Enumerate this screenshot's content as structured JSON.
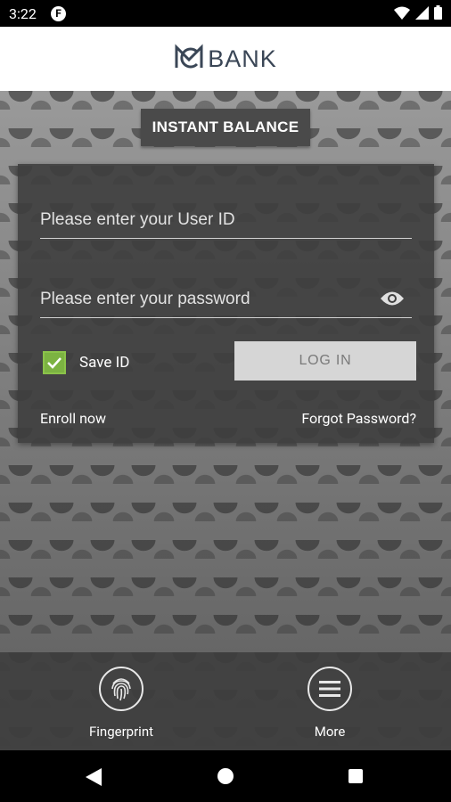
{
  "status_bar": {
    "time": "3:22",
    "app_icon_letter": "F",
    "icons": [
      "wifi-icon",
      "cellular-icon",
      "battery-icon"
    ]
  },
  "header": {
    "logo_icon": "mc-logo-icon",
    "logo_text": "BANK"
  },
  "instant_balance": {
    "label": "INSTANT BALANCE"
  },
  "login": {
    "user_id_placeholder": "Please enter your User ID",
    "password_placeholder": "Please enter your password",
    "show_password_icon": "eye-icon",
    "save_id_label": "Save ID",
    "save_id_checked": true,
    "login_button_label": "LOG IN",
    "enroll_label": "Enroll now",
    "forgot_password_label": "Forgot Password?"
  },
  "bottom_nav": {
    "items": [
      {
        "label": "Fingerprint",
        "icon": "fingerprint-icon"
      },
      {
        "label": "More",
        "icon": "menu-icon"
      }
    ]
  },
  "system_nav": {
    "icons": [
      "back-icon",
      "home-icon",
      "recent-apps-icon"
    ]
  },
  "colors": {
    "accent_green": "#7cb342",
    "card_bg": "#3e3e3e",
    "logo_text": "#3a4656"
  }
}
